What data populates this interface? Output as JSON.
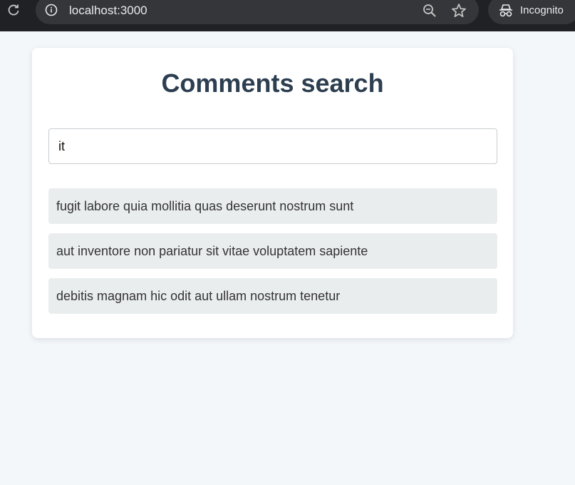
{
  "browser": {
    "url": "localhost:3000",
    "incognito_label": "Incognito",
    "icons": [
      "reload-icon",
      "info-icon",
      "zoom-out-icon",
      "star-icon",
      "incognito-icon"
    ]
  },
  "page": {
    "title": "Comments search",
    "search": {
      "value": "it",
      "placeholder": ""
    },
    "results": [
      "fugit labore quia mollitia quas deserunt nostrum sunt",
      "aut inventore non pariatur sit vitae voluptatem sapiente",
      "debitis magnam hic odit aut ullam nostrum tenetur"
    ]
  },
  "colors": {
    "background": "#f3f7fa",
    "card": "#ffffff",
    "title": "#2c3e50",
    "result_background": "#eaedee",
    "chrome": "#202124"
  }
}
